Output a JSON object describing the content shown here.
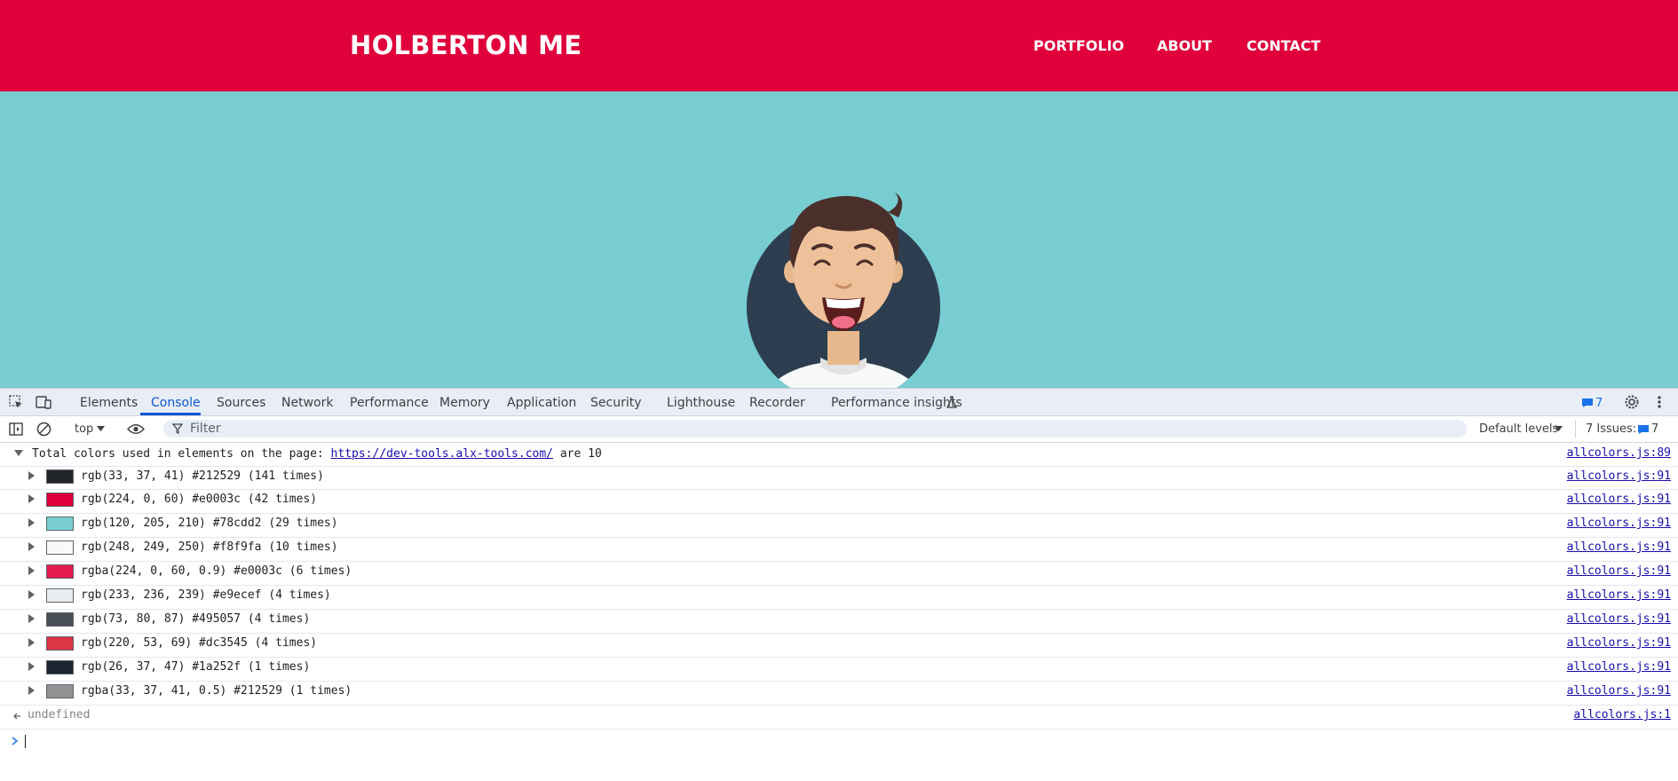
{
  "site": {
    "brand": "HOLBERTON ME",
    "nav": [
      "PORTFOLIO",
      "ABOUT",
      "CONTACT"
    ],
    "header_color": "#e0003c",
    "hero_color": "#78cdd2"
  },
  "devtools": {
    "tabs": [
      "Elements",
      "Console",
      "Sources",
      "Network",
      "Performance",
      "Memory",
      "Application",
      "Security",
      "Lighthouse",
      "Recorder",
      "Performance insights"
    ],
    "active_tab": "Console",
    "messages_count": "7",
    "context": "top",
    "filter_placeholder": "Filter",
    "levels": "Default levels",
    "issues_label": "7 Issues:",
    "issues_count": "7"
  },
  "console": {
    "header": {
      "text_before": "Total colors used in elements on the page: ",
      "url": "https://dev-tools.alx-tools.com/",
      "text_after": " are 10",
      "source": "allcolors.js:89"
    },
    "rows": [
      {
        "text": "rgb(33, 37, 41) #212529 (141 times)",
        "swatch": "#212529",
        "source": "allcolors.js:91"
      },
      {
        "text": "rgb(224, 0, 60) #e0003c (42 times)",
        "swatch": "#e0003c",
        "source": "allcolors.js:91"
      },
      {
        "text": "rgb(120, 205, 210) #78cdd2 (29 times)",
        "swatch": "#78cdd2",
        "source": "allcolors.js:91"
      },
      {
        "text": "rgb(248, 249, 250) #f8f9fa (10 times)",
        "swatch": "#f8f9fa",
        "source": "allcolors.js:91"
      },
      {
        "text": "rgba(224, 0, 60, 0.9) #e0003c (6 times)",
        "swatch": "#e31a50",
        "source": "allcolors.js:91"
      },
      {
        "text": "rgb(233, 236, 239) #e9ecef (4 times)",
        "swatch": "#e9ecef",
        "source": "allcolors.js:91"
      },
      {
        "text": "rgb(73, 80, 87) #495057 (4 times)",
        "swatch": "#495057",
        "source": "allcolors.js:91"
      },
      {
        "text": "rgb(220, 53, 69) #dc3545 (4 times)",
        "swatch": "#dc3545",
        "source": "allcolors.js:91"
      },
      {
        "text": "rgb(26, 37, 47) #1a252f (1 times)",
        "swatch": "#1a252f",
        "source": "allcolors.js:91"
      },
      {
        "text": "rgba(33, 37, 41, 0.5) #212529 (1 times)",
        "swatch": "#909294",
        "source": "allcolors.js:91"
      }
    ],
    "result": "undefined",
    "result_source": "allcolors.js:1"
  }
}
